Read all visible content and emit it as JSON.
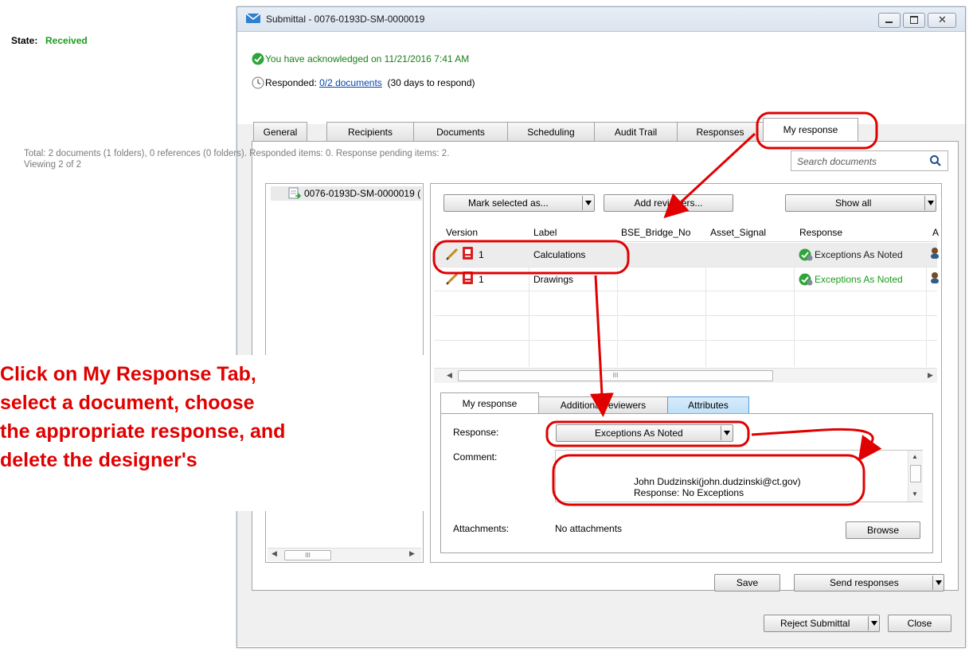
{
  "window": {
    "title": "Submittal - 0076-0193D-SM-0000019"
  },
  "header": {
    "state_label": "State:",
    "state_value": "Received",
    "acknowledged_text": "You have acknowledged on 11/21/2016 7:41 AM",
    "responded_label": "Responded:",
    "responded_link": "0/2 documents",
    "days_text": "(30 days to respond)"
  },
  "tabs": [
    {
      "label": "General"
    },
    {
      "label": "Recipients"
    },
    {
      "label": "Documents"
    },
    {
      "label": "Scheduling"
    },
    {
      "label": "Audit Trail"
    },
    {
      "label": "Responses"
    },
    {
      "label": "My response"
    }
  ],
  "info": {
    "line1": "Total: 2 documents (1 folders), 0 references (0 folders). Responded items: 0. Response pending items: 2.",
    "line2": "Viewing 2 of 2"
  },
  "search": {
    "placeholder": "Search documents"
  },
  "tree": {
    "root": "0076-0193D-SM-0000019 ("
  },
  "toolbar": {
    "mark_selected": "Mark selected as...",
    "add_reviewers": "Add reviewers...",
    "show_all": "Show all"
  },
  "grid": {
    "columns": [
      "Version",
      "Label",
      "BSE_Bridge_No",
      "Asset_Signal",
      "Response",
      "A"
    ],
    "rows": [
      {
        "version": "1",
        "label": "Calculations",
        "response": "Exceptions As Noted"
      },
      {
        "version": "1",
        "label": "Drawings",
        "response": "Exceptions As Noted"
      }
    ],
    "hscroll_grip": "III"
  },
  "response_tabs": [
    {
      "label": "My response"
    },
    {
      "label": "Additional reviewers"
    },
    {
      "label": "Attributes"
    }
  ],
  "response_form": {
    "response_label": "Response:",
    "response_value": "Exceptions As Noted",
    "comment_label": "Comment:",
    "comment_line1": "John Dudzinski(john.dudzinski@ct.gov)",
    "comment_line2": "Response: No Exceptions",
    "attachments_label": "Attachments:",
    "attachments_value": "No attachments",
    "browse": "Browse"
  },
  "actions": {
    "save": "Save",
    "send_responses": "Send responses",
    "reject_submittal": "Reject Submittal",
    "close": "Close"
  },
  "tree_scroll": {
    "grip": "III"
  },
  "annotation": {
    "lines": [
      "Click on My Response Tab,",
      "select a document, choose",
      "the appropriate response, and",
      "delete the designer's"
    ],
    "color": "#e00000"
  }
}
